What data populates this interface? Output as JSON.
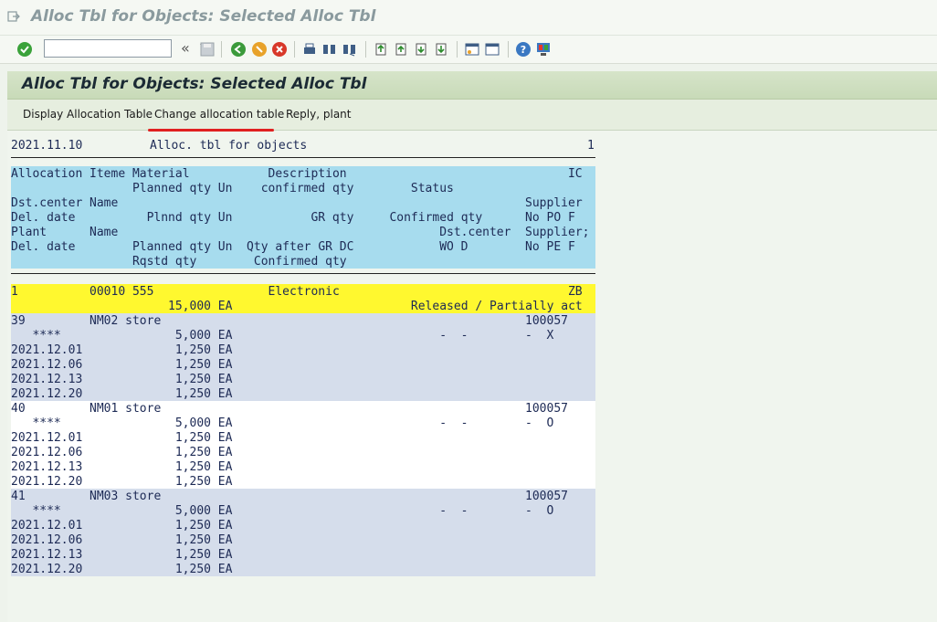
{
  "window": {
    "title": "Alloc Tbl for Objects: Selected Alloc Tbl"
  },
  "screen": {
    "title": "Alloc Tbl for Objects: Selected Alloc Tbl"
  },
  "appbar": {
    "display": "Display Allocation Table",
    "change": "Change allocation table",
    "reply": "Reply, plant"
  },
  "report": {
    "date": "2021.11.10",
    "title": "Alloc. tbl for objects",
    "page": "1"
  },
  "headers": [
    [
      "Allocation",
      "Iteme",
      "Material",
      "Description",
      "",
      "IC"
    ],
    [
      "",
      "",
      "Planned qty",
      "Un",
      "confirmed qty",
      "Status"
    ],
    [
      "Dst.center",
      "Name",
      "",
      "",
      "",
      "Supplier"
    ],
    [
      "Del. date",
      "",
      "Plnnd qty",
      "Un",
      "GR qty",
      "Confirmed qty",
      "No PO F"
    ],
    [
      "Plant",
      "Name",
      "",
      "",
      "Dst.center",
      "Supplier;"
    ],
    [
      "Del. date",
      "",
      "Planned qty",
      "Un",
      "Qty after GR DC",
      "WO D",
      "No PE F"
    ],
    [
      "",
      "",
      "Rqstd qty",
      "",
      "Confirmed qty"
    ]
  ],
  "item": {
    "alloc": "1",
    "item": "00010",
    "material": "555",
    "desc": "Electronic",
    "ic": "ZB",
    "qty": "15,000",
    "un": "EA",
    "status": "Released / Partially act"
  },
  "stores": [
    {
      "dst": "39",
      "name": "NM02 store",
      "supplier": "100057",
      "stars": "****",
      "qty": "5,000",
      "un": "EA",
      "d1": "-",
      "d2": "-",
      "d3": "-",
      "flag": "X",
      "dates": [
        [
          "2021.12.01",
          "1,250",
          "EA"
        ],
        [
          "2021.12.06",
          "1,250",
          "EA"
        ],
        [
          "2021.12.13",
          "1,250",
          "EA"
        ],
        [
          "2021.12.20",
          "1,250",
          "EA"
        ]
      ]
    },
    {
      "dst": "40",
      "name": "NM01 store",
      "supplier": "100057",
      "stars": "****",
      "qty": "5,000",
      "un": "EA",
      "d1": "-",
      "d2": "-",
      "d3": "-",
      "flag": "O",
      "dates": [
        [
          "2021.12.01",
          "1,250",
          "EA"
        ],
        [
          "2021.12.06",
          "1,250",
          "EA"
        ],
        [
          "2021.12.13",
          "1,250",
          "EA"
        ],
        [
          "2021.12.20",
          "1,250",
          "EA"
        ]
      ]
    },
    {
      "dst": "41",
      "name": "NM03 store",
      "supplier": "100057",
      "stars": "****",
      "qty": "5,000",
      "un": "EA",
      "d1": "-",
      "d2": "-",
      "d3": "-",
      "flag": "O",
      "dates": [
        [
          "2021.12.01",
          "1,250",
          "EA"
        ],
        [
          "2021.12.06",
          "1,250",
          "EA"
        ],
        [
          "2021.12.13",
          "1,250",
          "EA"
        ],
        [
          "2021.12.20",
          "1,250",
          "EA"
        ]
      ]
    }
  ]
}
